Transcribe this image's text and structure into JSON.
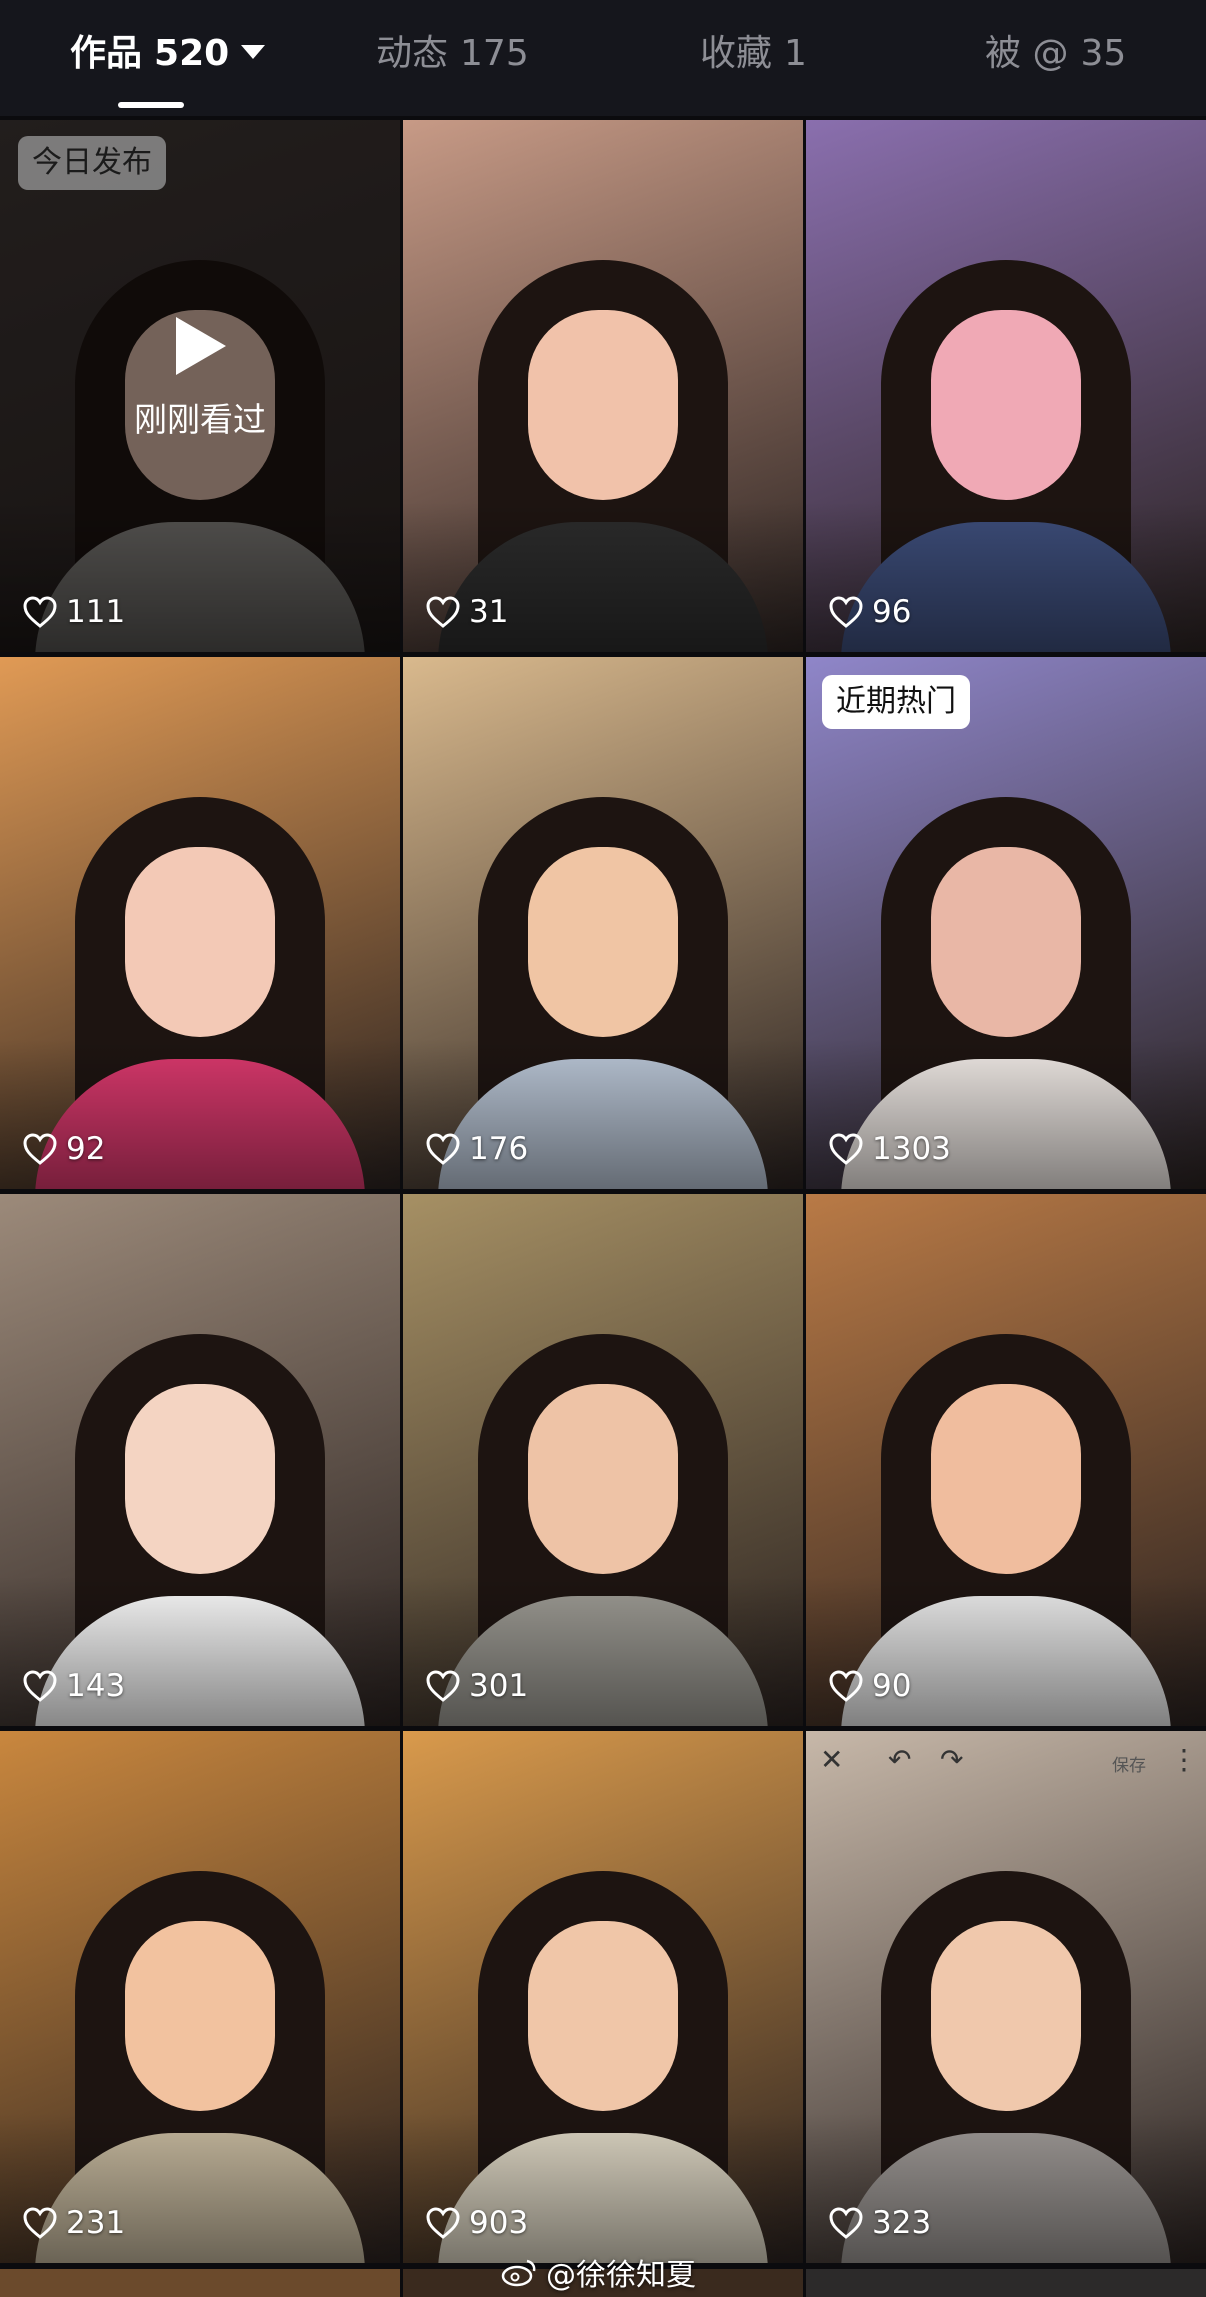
{
  "tabs": [
    {
      "label": "作品",
      "count": "520",
      "active": true
    },
    {
      "label": "动态",
      "count": "175",
      "active": false
    },
    {
      "label": "收藏",
      "count": "1",
      "active": false
    },
    {
      "label": "被 @",
      "count": "35",
      "active": false
    }
  ],
  "videos": [
    {
      "likes": "111",
      "badge": "今日发布",
      "overlay_text": "刚刚看过",
      "bg": "#3b3432",
      "skin": "#c9a99a",
      "shirt": "#8d8a86"
    },
    {
      "likes": "31",
      "bg": "#c79a86",
      "skin": "#f1c2aa",
      "shirt": "#2b2b2b"
    },
    {
      "likes": "96",
      "bg": "#8a6fae",
      "skin": "#f0a9b5",
      "shirt": "#3c4c78"
    },
    {
      "likes": "92",
      "bg": "#e09a55",
      "skin": "#f3c9b6",
      "shirt": "#d8386c"
    },
    {
      "likes": "176",
      "bg": "#d9b98d",
      "skin": "#f0c5a4",
      "shirt": "#b7c3d3"
    },
    {
      "likes": "1303",
      "badge": "近期热门",
      "bg": "#8f86c9",
      "skin": "#e9b7a6",
      "shirt": "#ece6e2"
    },
    {
      "likes": "143",
      "bg": "#9c8a7a",
      "skin": "#f4d4c2",
      "shirt": "#f6f6f6"
    },
    {
      "likes": "301",
      "bg": "#a69064",
      "skin": "#eec3a6",
      "shirt": "#9a9891"
    },
    {
      "likes": "90",
      "bg": "#b97a46",
      "skin": "#f0bd9e",
      "shirt": "#e8e8e8"
    },
    {
      "likes": "231",
      "bg": "#c9873e",
      "skin": "#f2c29f",
      "shirt": "#c2b59b"
    },
    {
      "likes": "903",
      "bg": "#d99a4c",
      "skin": "#f0c6a8",
      "shirt": "#d9d2c0"
    },
    {
      "likes": "323",
      "bg": "#c7b8a9",
      "skin": "#f0c8ac",
      "shirt": "#9a9592",
      "editor_save": "保存"
    }
  ],
  "watermark": "@徐徐知夏",
  "colors": {
    "tabbar": "#15161c",
    "page": "#0b0b0e",
    "active_tab": "#ffffff",
    "inactive_tab": "#8d8e95"
  }
}
